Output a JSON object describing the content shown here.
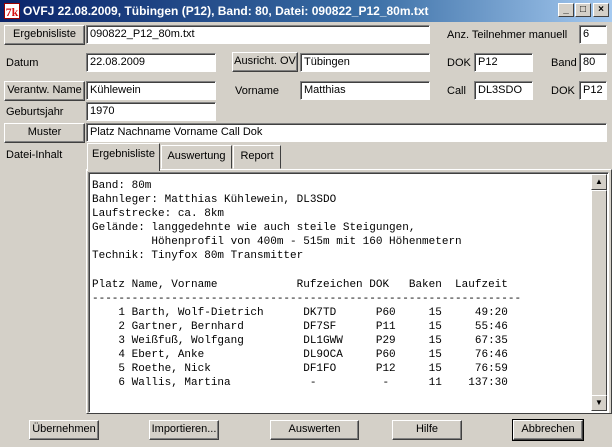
{
  "window": {
    "title": "OVFJ 22.08.2009, Tübingen (P12), Band: 80, Datei: 090822_P12_80m.txt",
    "app_icon": "7k",
    "minimize": "_",
    "maximize": "□",
    "close": "×"
  },
  "form": {
    "ergebnisliste_button": "Ergebnisliste",
    "ergebnisliste_file": "090822_P12_80m.txt",
    "teilnehmer_label": "Anz. Teilnehmer manuell",
    "teilnehmer_value": "6",
    "datum_label": "Datum",
    "datum_value": "22.08.2009",
    "ausricht_button": "Ausricht. OV",
    "ausricht_value": "Tübingen",
    "dok_label": "DOK",
    "dok_value": "P12",
    "band_label": "Band",
    "band_value": "80",
    "verantw_button": "Verantw. Name",
    "verantw_value": "Kühlewein",
    "vorname_label": "Vorname",
    "vorname_value": "Matthias",
    "call_label": "Call",
    "call_value": "DL3SDO",
    "dok2_label": "DOK",
    "dok2_value": "P12",
    "geburtsjahr_label": "Geburtsjahr",
    "geburtsjahr_value": "1970",
    "muster_button": "Muster",
    "muster_value": "Platz Nachname Vorname Call Dok",
    "dateiinhalt_label": "Datei-Inhalt"
  },
  "tabs": [
    {
      "label": "Ergebnisliste",
      "active": true
    },
    {
      "label": "Auswertung",
      "active": false
    },
    {
      "label": "Report",
      "active": false
    }
  ],
  "content": {
    "lines": [
      "Band: 80m",
      "Bahnleger: Matthias Kühlewein, DL3SDO",
      "Laufstrecke: ca. 8km",
      "Gelände: langgedehnte wie auch steile Steigungen,",
      "         Höhenprofil von 400m - 515m mit 160 Höhenmetern",
      "Technik: Tinyfox 80m Transmitter",
      "",
      "Platz Name, Vorname            Rufzeichen DOK   Baken  Laufzeit",
      "-----------------------------------------------------------------",
      "    1 Barth, Wolf-Dietrich      DK7TD      P60     15     49:20",
      "    2 Gartner, Bernhard         DF7SF      P11     15     55:46",
      "    3 Weißfuß, Wolfgang         DL1GWW     P29     15     67:35",
      "    4 Ebert, Anke               DL9OCA     P60     15     76:46",
      "    5 Roethe, Nick              DF1FO      P12     15     76:59",
      "    6 Wallis, Martina            -          -      11    137:30"
    ]
  },
  "scrollbar": {
    "up": "▲",
    "down": "▼"
  },
  "buttons": {
    "uebernehmen": "Übernehmen",
    "importieren": "Importieren...",
    "auswerten": "Auswerten",
    "hilfe": "Hilfe",
    "abbrechen": "Abbrechen"
  }
}
